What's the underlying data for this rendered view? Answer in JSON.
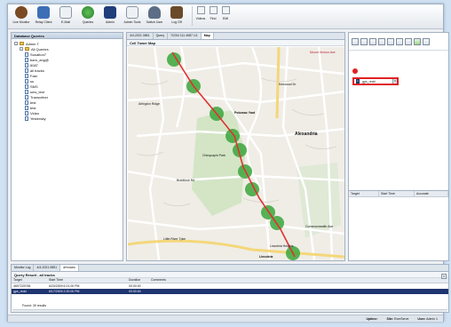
{
  "toolbar": {
    "buttons": [
      {
        "label": "Live Monitor",
        "icon": "live-monitor-icon",
        "color": "#7a4a24"
      },
      {
        "label": "Relay Client",
        "icon": "relay-client-icon",
        "color": "#3d6fb6"
      },
      {
        "label": "E-Mail",
        "icon": "email-icon",
        "color": "#8a96a6"
      },
      {
        "label": "Queries",
        "icon": "queries-icon",
        "color": "#3b9a3a"
      },
      {
        "label": "Admin",
        "icon": "admin-icon",
        "color": "#1f3e7a"
      },
      {
        "label": "Admin Tools",
        "icon": "admin-tools-icon",
        "color": "#8a96a6"
      },
      {
        "label": "Switch User",
        "icon": "switch-user-icon",
        "color": "#5c6d85"
      },
      {
        "label": "Log Off",
        "icon": "log-off-icon",
        "color": "#6b4a2a"
      }
    ],
    "small": [
      {
        "label": "Videos"
      },
      {
        "label": "Find"
      },
      {
        "label": "EMI"
      }
    ]
  },
  "database_queries": {
    "title": "Database Queries",
    "tree": [
      {
        "label": "Admin T",
        "depth": 0,
        "type": "user"
      },
      {
        "label": "All Queries",
        "depth": 1,
        "type": "folder"
      },
      {
        "label": "Sunalton7",
        "depth": 2,
        "type": "item"
      },
      {
        "label": "barn_ang@",
        "depth": 2,
        "type": "item"
      },
      {
        "label": "6087",
        "depth": 2,
        "type": "item"
      },
      {
        "label": "all tracks",
        "depth": 2,
        "type": "item"
      },
      {
        "label": "Fast",
        "depth": 2,
        "type": "item"
      },
      {
        "label": "ss",
        "depth": 2,
        "type": "item"
      },
      {
        "label": "SMS",
        "depth": 2,
        "type": "item"
      },
      {
        "label": "sms_test",
        "depth": 2,
        "type": "item"
      },
      {
        "label": "Transcriber",
        "depth": 2,
        "type": "item"
      },
      {
        "label": "test",
        "depth": 2,
        "type": "item"
      },
      {
        "label": "test",
        "depth": 2,
        "type": "item"
      },
      {
        "label": "Video",
        "depth": 2,
        "type": "item"
      },
      {
        "label": "Yesterday",
        "depth": 2,
        "type": "item"
      }
    ]
  },
  "center": {
    "tabs": [
      {
        "label": "4/4-2021 0851",
        "active": false
      },
      {
        "label": "Query",
        "active": false
      },
      {
        "label": "7/23/4 111 4987 1/1",
        "active": false
      },
      {
        "label": "Map",
        "active": true
      }
    ],
    "map_title": "Cell Tower Map",
    "map_labels": [
      {
        "text": "Kenwood Dr"
      },
      {
        "text": "Mount Vernon Ave"
      },
      {
        "text": "Alexandria"
      },
      {
        "text": "Potomac Yard"
      },
      {
        "text": "Chinquapin Park"
      },
      {
        "text": "Commonwealth Ave"
      },
      {
        "text": "Braddock Rd"
      },
      {
        "text": "Lincolnia Heights"
      },
      {
        "text": "Little River Tpke"
      },
      {
        "text": "Lincolnia"
      },
      {
        "text": "Arlington Ridge"
      }
    ]
  },
  "right": {
    "selector_num": "1",
    "selector_value": "gps_redd",
    "table_headers": [
      "Target",
      "Start Time",
      "Accurate"
    ]
  },
  "bottom": {
    "tabs": [
      {
        "label": "Monitor Log",
        "active": false
      },
      {
        "label": "4/4-2021 0851",
        "active": false
      },
      {
        "label": "all tracks",
        "active": true
      }
    ],
    "query_title": "Query Result - all tracks",
    "headers": [
      "Target",
      "Start Time",
      "Duration",
      "Comments"
    ],
    "rows": [
      {
        "target": "4697229784",
        "start": "6/20/2009 6:21:00 PM",
        "duration": "00:00:00",
        "comments": "",
        "selected": false
      },
      {
        "target": "gps_redd",
        "start": "6/17/2009 2:20:00 PM",
        "duration": "00:00:00",
        "comments": "",
        "selected": true
      }
    ],
    "found": "Found: 39 results"
  },
  "status": {
    "uptime_label": "Uptime:",
    "uptime_value": "",
    "site_label": "Site:",
    "site_value": "EverServe",
    "user_label": "User:",
    "user_value": "Admin 1"
  },
  "colors": {
    "track": "#e03030",
    "tower": "#3aa63a",
    "park": "#d3e5c5",
    "road": "#ffffff",
    "selection": "#1f3570"
  }
}
